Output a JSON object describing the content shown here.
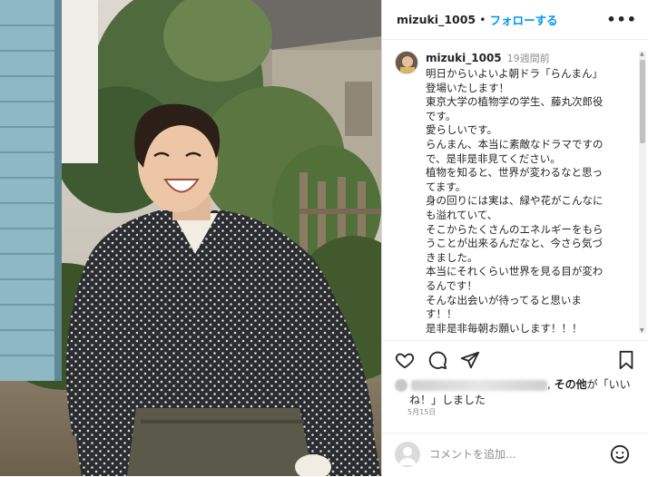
{
  "post": {
    "username": "mizuki_1005",
    "separator": "•",
    "follow_label": "フォローする",
    "more_label": "•••",
    "time_ago": "19週間前",
    "caption_lines": [
      "明日からいよいよ朝ドラ「らんまん」",
      "登場いたします！",
      "東京大学の植物学の学生、藤丸次郎役",
      "です。",
      "愛らしいです。",
      "らんまん、本当に素敵なドラマですの",
      "で、是非是非見てください。",
      "植物を知ると、世界が変わるなと思っ",
      "てます。",
      "身の回りには実は、緑や花がこんなに",
      "も溢れていて、",
      "そこからたくさんのエネルギーをもら",
      "うことが出来るんだなと、今さら気づ",
      "きました。",
      "本当にそれくらい世界を見る目が変わ",
      "るんです！",
      "そんな出会いが待ってると思いま",
      "す！！",
      "是非是非毎朝お願いします！！！"
    ],
    "likes": {
      "suffix_bold": "その他",
      "suffix_text_1": "が「いい",
      "suffix_text_2": "ね！」しました"
    },
    "date": "5月15日",
    "comment_placeholder": "コメントを追加..."
  },
  "icons": {
    "like": "heart-icon",
    "comment": "comment-icon",
    "share": "paper-plane-icon",
    "save": "bookmark-icon",
    "emoji": "smiley-icon"
  }
}
